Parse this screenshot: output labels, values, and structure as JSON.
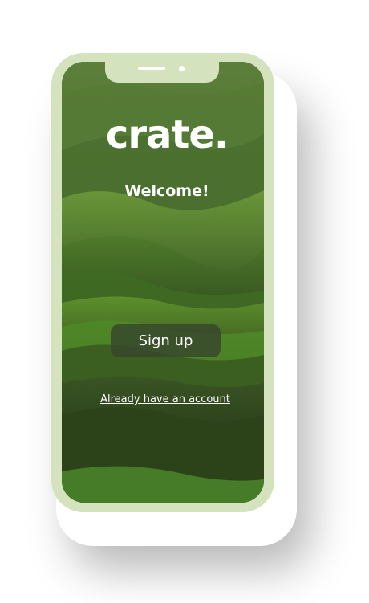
{
  "app": {
    "logo_text": "crate.",
    "welcome_text": "Welcome!"
  },
  "actions": {
    "signup_label": "Sign up",
    "login_link_label": "Already have an account"
  },
  "colors": {
    "frame": "#d4e2bd",
    "button_bg": "#37462d",
    "text": "#ffffff"
  }
}
